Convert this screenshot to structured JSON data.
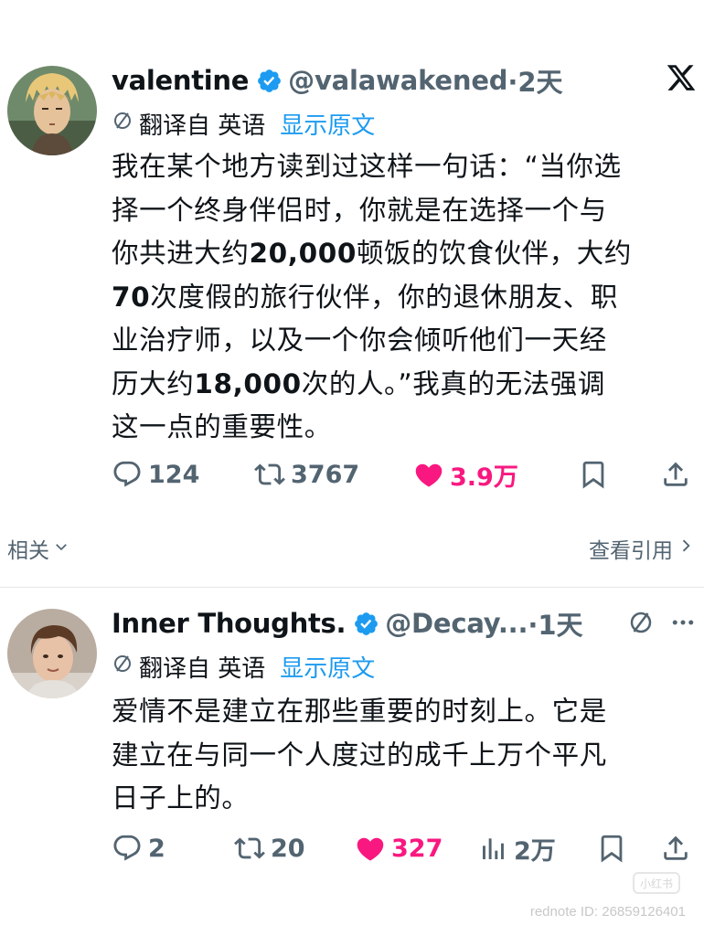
{
  "tweet1": {
    "display_name": "valentine",
    "handle": "@valawakened",
    "time": "·2天",
    "translate_label": "翻译自 英语",
    "show_original": "显示原文",
    "text_lines": [
      "我在某个地方读到过这样一句话：“当你选",
      "择一个终身伴侣时，你就是在选择一个与",
      "你共进大约20,000顿饭的饮食伙伴，大约",
      "70次度假的旅行伙伴，你的退休朋友、职",
      "业治疗师，以及一个你会倾听他们一天经",
      "历大约18,000次的人。”我真的无法强调",
      "这一点的重要性。"
    ],
    "replies": "124",
    "retweets": "3767",
    "likes": "3.9万"
  },
  "related": {
    "left_label": "相关",
    "right_label": "查看引用"
  },
  "tweet2": {
    "display_name": "Inner Thoughts.",
    "handle": "@Decay...",
    "time": "·1天",
    "translate_label": "翻译自 英语",
    "show_original": "显示原文",
    "text_lines": [
      "爱情不是建立在那些重要的时刻上。它是",
      "建立在与同一个人度过的成千上万个平凡",
      "日子上的。"
    ],
    "replies": "2",
    "retweets": "20",
    "likes": "327",
    "views": "2万"
  },
  "watermark": {
    "logo_text": "小红书",
    "id_text": "rednote ID: 26859126401"
  },
  "colors": {
    "accent": "#1d9bf0",
    "like": "#f91880",
    "muted": "#536471",
    "text": "#0f1419"
  }
}
